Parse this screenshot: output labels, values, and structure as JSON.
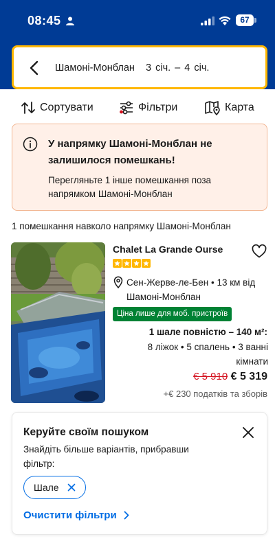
{
  "status_bar": {
    "time": "08:45",
    "battery": "67"
  },
  "search": {
    "destination": "Шамоні-Монблан",
    "dates": "3 січ. – 4 січ."
  },
  "toolbar": {
    "sort_label": "Сортувати",
    "filter_label": "Фільтри",
    "map_label": "Карта"
  },
  "alert": {
    "title": "У напрямку Шамоні-Монблан не залишилося помешкань!",
    "body": "Перегляньте 1 інше помешкання поза напрямком Шамоні-Монблан"
  },
  "results_count": "1 помешкання навколо напрямку Шамоні-Монблан",
  "property": {
    "name": "Chalet La Grande Ourse",
    "stars": 4,
    "location": "Сен-Жерве-ле-Бен • 13 км від Шамоні-Монблан",
    "badge": "Ціна лише для моб. пристроїв",
    "unit_title": "1 шале повністю – 140 м²:",
    "unit_details": "8 ліжок • 5 спалень • 3 ванні кімнати",
    "price_old": "€ 5 910",
    "price_new": "€ 5 319",
    "taxes": "+€ 230 податків та зборів"
  },
  "filter_card": {
    "title": "Керуйте своїм пошуком",
    "text": "Знайдіть більше варіантів, прибравши фільтр:",
    "chip_label": "Шале",
    "clear_label": "Очистити фільтри"
  },
  "colors": {
    "brand_blue": "#003b95",
    "accent_yellow": "#ffb700",
    "link_blue": "#006ce4",
    "deal_green": "#008234",
    "old_price_red": "#d4111e"
  }
}
